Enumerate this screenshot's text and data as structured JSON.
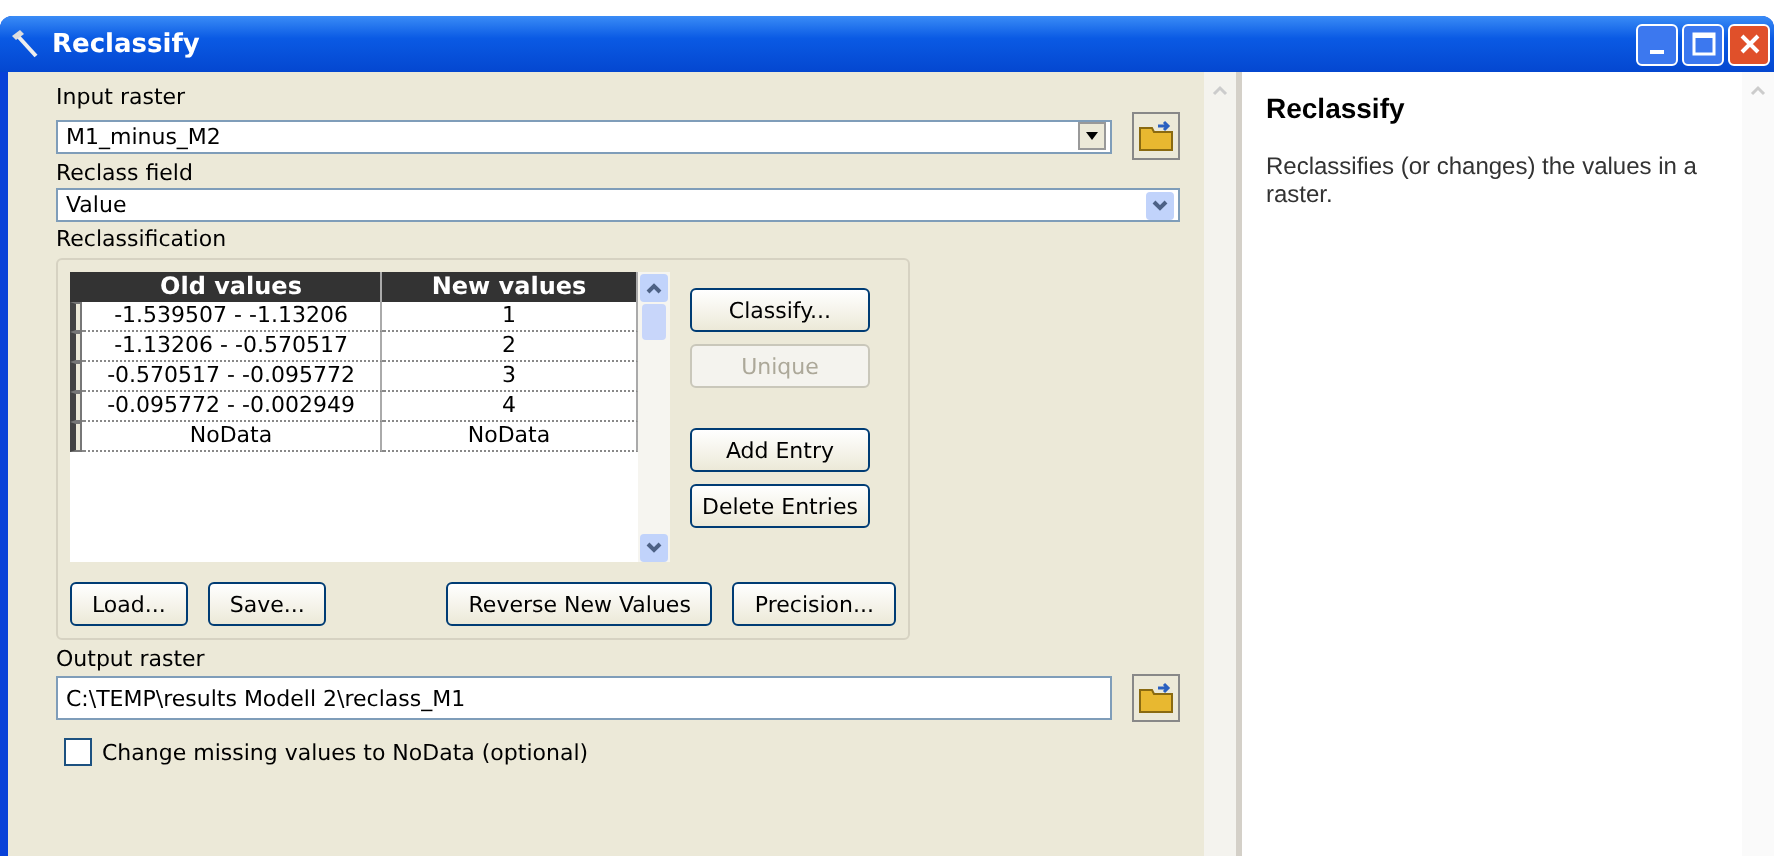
{
  "window": {
    "title": "Reclassify"
  },
  "input_raster": {
    "label": "Input raster",
    "value": "M1_minus_M2"
  },
  "reclass_field": {
    "label": "Reclass field",
    "value": "Value"
  },
  "reclassification": {
    "label": "Reclassification",
    "columns": [
      "Old values",
      "New values"
    ],
    "rows": [
      {
        "old": "-1.539507 - -1.13206",
        "new": "1"
      },
      {
        "old": "-1.13206 - -0.570517",
        "new": "2"
      },
      {
        "old": "-0.570517 - -0.095772",
        "new": "3"
      },
      {
        "old": "-0.095772 - -0.002949",
        "new": "4"
      },
      {
        "old": "NoData",
        "new": "NoData"
      }
    ],
    "side_buttons": [
      {
        "label": "Classify...",
        "disabled": false
      },
      {
        "label": "Unique",
        "disabled": true
      },
      {
        "label": "Add Entry",
        "disabled": false
      },
      {
        "label": "Delete Entries",
        "disabled": false
      }
    ],
    "bottom_buttons": [
      {
        "label": "Load...",
        "disabled": false
      },
      {
        "label": "Save...",
        "disabled": false
      },
      {
        "label": "Reverse New Values",
        "disabled": false
      },
      {
        "label": "Precision...",
        "disabled": false
      }
    ]
  },
  "output_raster": {
    "label": "Output raster",
    "value": "C:\\TEMP\\results Modell 2\\reclass_M1"
  },
  "missing_to_nodata": {
    "label": "Change missing values to NoData (optional)",
    "checked": false
  },
  "help": {
    "title": "Reclassify",
    "text": "Reclassifies (or changes) the values in a raster."
  }
}
